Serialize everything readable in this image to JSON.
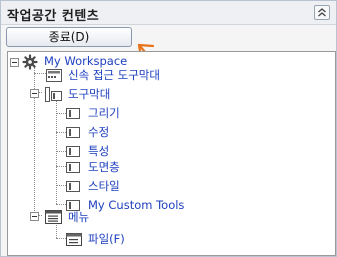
{
  "panel": {
    "title": "작업공간 컨텐츠",
    "collapse_icon": "double-chevron-up-icon"
  },
  "toolbar": {
    "close_label": "종료(D)"
  },
  "tree": {
    "root": "My Workspace",
    "quick_access": "신속 접근 도구막대",
    "toolbars": "도구막대",
    "toolbar_items": [
      "그리기",
      "수정",
      "특성",
      "도면층",
      "스타일",
      "My Custom Tools"
    ],
    "menu": "메뉴",
    "menu_items": [
      "파일(F)"
    ]
  },
  "colors": {
    "tree_link": "#1d3fbf",
    "annotation_arrow": "#e8731a"
  }
}
